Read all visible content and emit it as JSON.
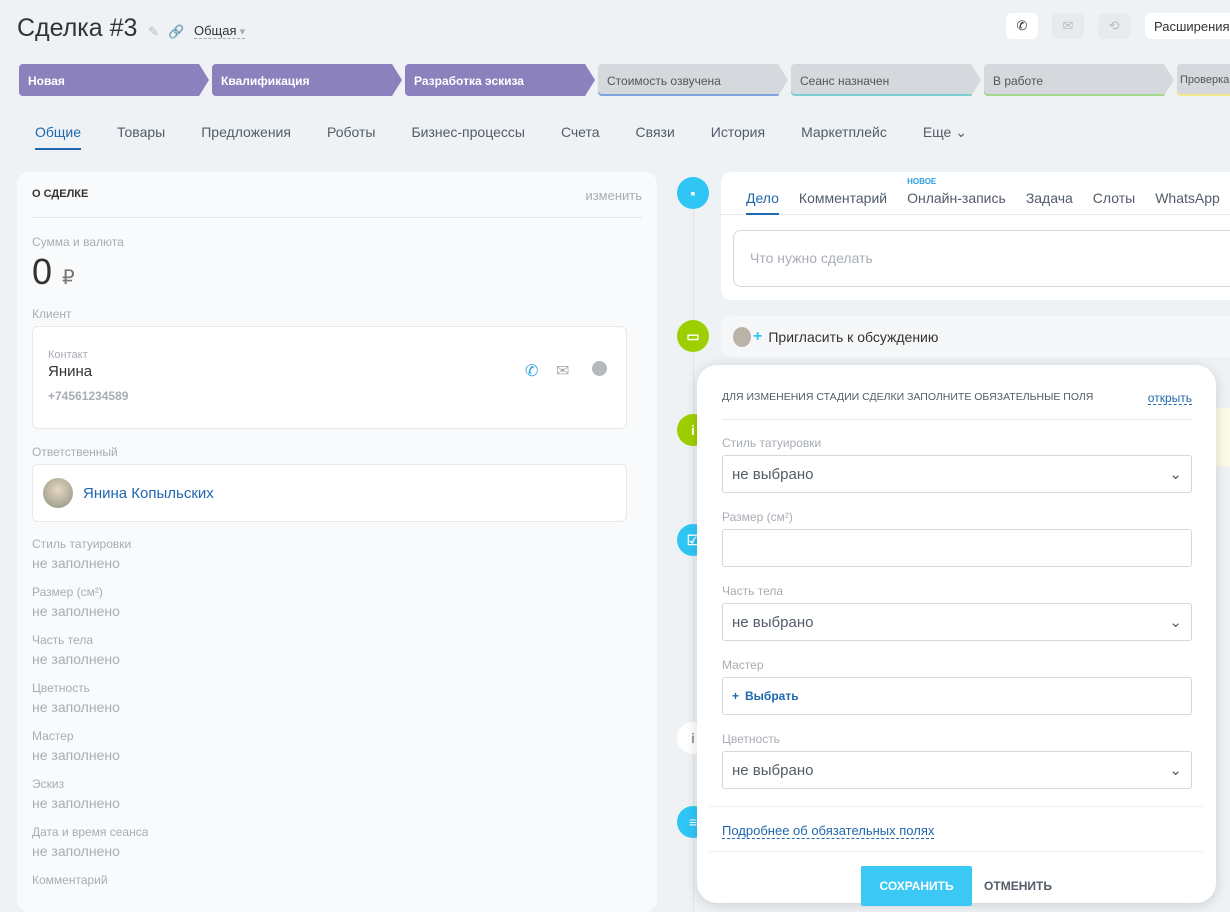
{
  "header": {
    "title": "Сделка #3",
    "category": "Общая",
    "extensions": "Расширения"
  },
  "stages": [
    {
      "label": "Новая",
      "color": "#8b82bd"
    },
    {
      "label": "Квалификация",
      "color": "#8b82bd"
    },
    {
      "label": "Разработка эскиза",
      "color": "#8b82bd"
    },
    {
      "label": "Стоимость озвучена",
      "color": "#7ea6da"
    },
    {
      "label": "Сеанс назначен",
      "color": "#7ad0cc"
    },
    {
      "label": "В работе",
      "color": "#a5d88f"
    },
    {
      "label": "Проверка",
      "color": "#f5e88a"
    }
  ],
  "tabs": [
    "Общие",
    "Товары",
    "Предложения",
    "Роботы",
    "Бизнес-процессы",
    "Счета",
    "Связи",
    "История",
    "Маркетплейс",
    "Еще"
  ],
  "panel": {
    "title": "О СДЕЛКЕ",
    "edit": "изменить",
    "sum_label": "Сумма и валюта",
    "sum": "0",
    "currency": "₽",
    "client_label": "Клиент",
    "contact_label": "Контакт",
    "contact_name": "Янина",
    "contact_phone": "+74561234589",
    "responsible_label": "Ответственный",
    "responsible": "Янина Копыльских",
    "fields": [
      {
        "label": "Стиль татуировки",
        "value": "не заполнено"
      },
      {
        "label": "Размер (см²)",
        "value": "не заполнено"
      },
      {
        "label": "Часть тела",
        "value": "не заполнено"
      },
      {
        "label": "Цветность",
        "value": "не заполнено"
      },
      {
        "label": "Мастер",
        "value": "не заполнено"
      },
      {
        "label": "Эскиз",
        "value": "не заполнено"
      },
      {
        "label": "Дата и время сеанса",
        "value": "не заполнено"
      },
      {
        "label": "Комментарий",
        "value": ""
      }
    ]
  },
  "editor": {
    "tabs": [
      "Дело",
      "Комментарий",
      "Онлайн-запись",
      "Задача",
      "Слоты",
      "WhatsApp"
    ],
    "new_badge": "НОВОЕ",
    "placeholder": "Что нужно сделать",
    "invite": "Пригласить к обсуждению"
  },
  "popup": {
    "title": "ДЛЯ ИЗМЕНЕНИЯ СТАДИИ СДЕЛКИ ЗАПОЛНИТЕ ОБЯЗАТЕЛЬНЫЕ ПОЛЯ",
    "open": "открыть",
    "style_label": "Стиль татуировки",
    "style_value": "не выбрано",
    "size_label": "Размер (см²)",
    "size_value": "",
    "body_label": "Часть тела",
    "body_value": "не выбрано",
    "master_label": "Мастер",
    "master_select": "Выбрать",
    "color_label": "Цветность",
    "color_value": "не выбрано",
    "more": "Подробнее об обязательных полях",
    "save": "СОХРАНИТЬ",
    "cancel": "ОТМЕНИТЬ"
  }
}
